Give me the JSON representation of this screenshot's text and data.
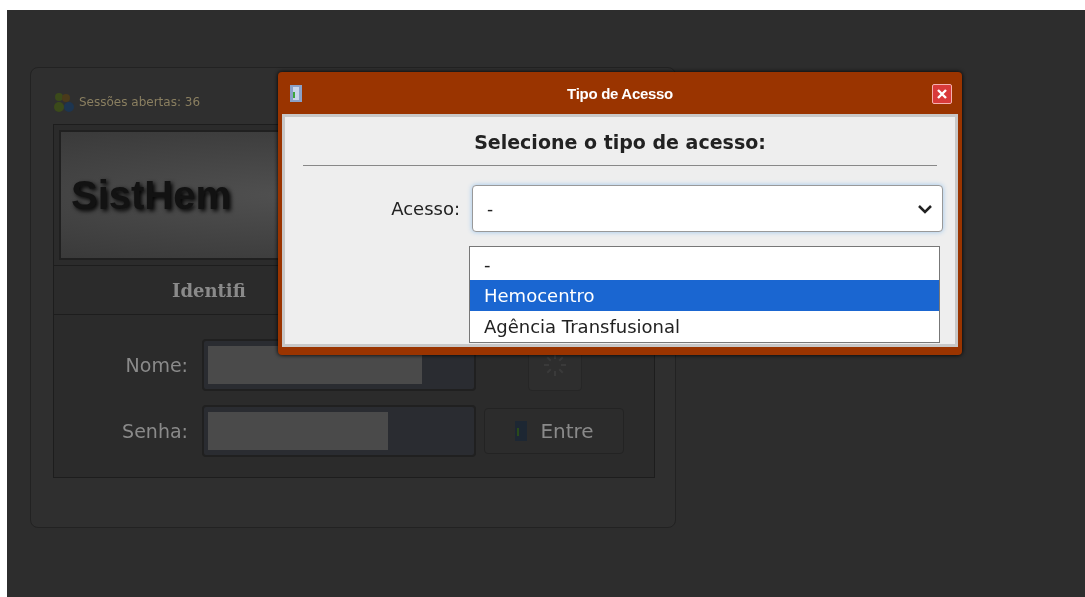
{
  "login": {
    "sessions_label": "Sessões abertas: 36",
    "logo": "SistHem",
    "section_title": "Identifi",
    "fields": [
      {
        "label": "Nome:"
      },
      {
        "label": "Senha:"
      }
    ],
    "enter_button": "Entre"
  },
  "dialog": {
    "title": "Tipo de Acesso",
    "heading": "Selecione o tipo de acesso:",
    "field_label": "Acesso:",
    "select_value": "-",
    "options": [
      {
        "label": "-",
        "selected": false
      },
      {
        "label": "Hemocentro",
        "selected": true
      },
      {
        "label": "Agência Transfusional",
        "selected": false
      }
    ]
  }
}
